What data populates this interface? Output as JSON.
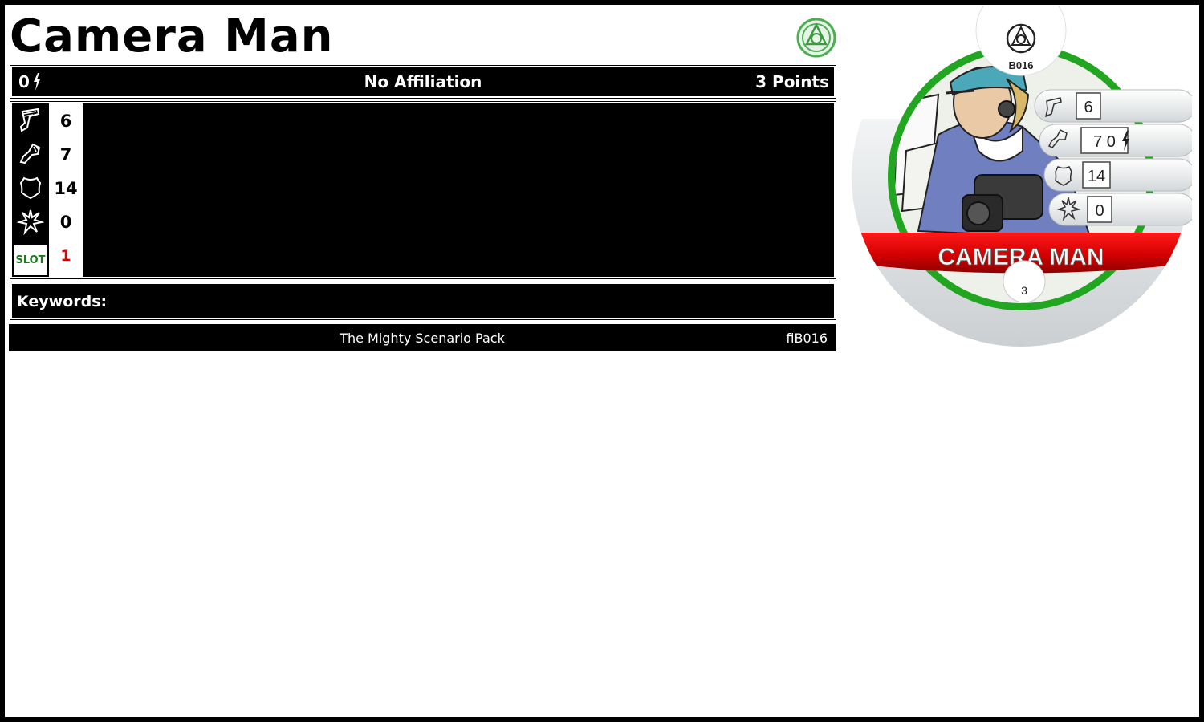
{
  "character": {
    "name": "Camera Man",
    "affiliation": "No Affiliation",
    "points": "3 Points",
    "range_value": "0",
    "keywords_label": "Keywords:",
    "keywords": ""
  },
  "stats": {
    "speed": "6",
    "attack": "7",
    "defense": "14",
    "damage": "0",
    "slot_label": "SLOT",
    "slot_value": "1"
  },
  "footer": {
    "set_name": "The Mighty Scenario Pack",
    "collector_code": "fiB016"
  },
  "dial": {
    "name": "CAMERA MAN",
    "code": "B016",
    "point_value": "3",
    "speed": "6",
    "attack_range": "7 0",
    "defense": "14",
    "damage": "0"
  },
  "icons": {
    "rank": "rank-symbol-icon",
    "range_bolt": "lightning-bolt-icon",
    "speed": "boot-icon",
    "attack": "fist-icon",
    "defense": "shield-icon",
    "damage": "starburst-icon"
  },
  "colors": {
    "slot_label": "#1f7a1f",
    "slot_value": "#e00000",
    "dial_ring": "#22a622",
    "dial_banner": "#d40000"
  }
}
